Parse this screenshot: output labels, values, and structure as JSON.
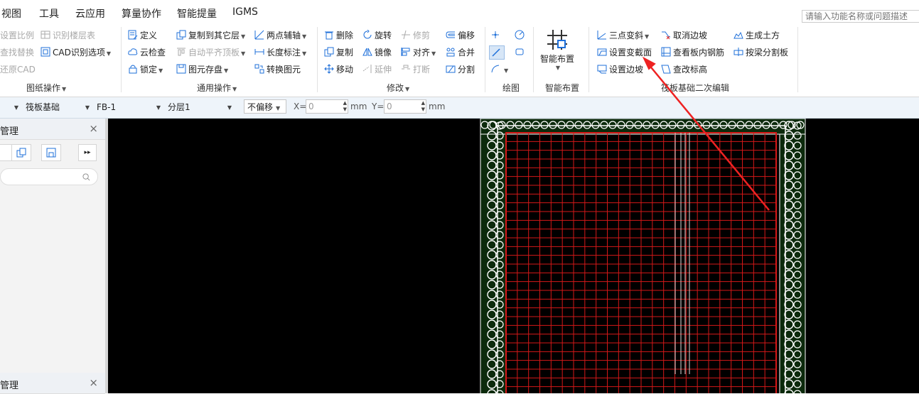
{
  "menubar": {
    "items": [
      "视图",
      "工具",
      "云应用",
      "算量协作",
      "智能提量",
      "IGMS"
    ],
    "search_placeholder": "请输入功能名称或问题描述"
  },
  "ribbon": {
    "drawing_ops": {
      "label": "图纸操作",
      "buttons": [
        "设置比例",
        "识别楼层表",
        "查找替换",
        "CAD识别选项",
        "还原CAD"
      ]
    },
    "common_ops": {
      "label": "通用操作",
      "buttons": [
        "定义",
        "复制到其它层",
        "两点辅轴",
        "云检查",
        "自动平齐顶板",
        "长度标注",
        "锁定",
        "图元存盘",
        "转换图元"
      ]
    },
    "modify": {
      "label": "修改",
      "buttons": [
        "删除",
        "旋转",
        "修剪",
        "偏移",
        "复制",
        "镜像",
        "对齐",
        "合并",
        "移动",
        "延伸",
        "打断",
        "分割"
      ]
    },
    "draw": {
      "label": "绘图"
    },
    "smart": {
      "label": "智能布置",
      "big_button": "智能布置"
    },
    "raft": {
      "label": "筏板基础二次编辑",
      "buttons": [
        "三点变斜",
        "取消边坡",
        "生成土方",
        "设置变截面",
        "查看板内钢筋",
        "按梁分割板",
        "设置边坡",
        "查改标高"
      ]
    }
  },
  "toolbar2": {
    "component_type": "筏板基础",
    "component": "FB-1",
    "layer": "分层1",
    "offset_mode": "不偏移",
    "x_label": "X=",
    "x_value": "0",
    "y_label": "Y=",
    "y_value": "0",
    "unit": "mm"
  },
  "panels": {
    "top_title": "管理",
    "bottom_title": "管理",
    "close": "×"
  },
  "colors": {
    "accent": "#1e6fd9",
    "canvas_bg": "#000000",
    "grid_red": "#d41818",
    "annotation_white": "#ffffff",
    "arrow_red": "#ee2222"
  }
}
